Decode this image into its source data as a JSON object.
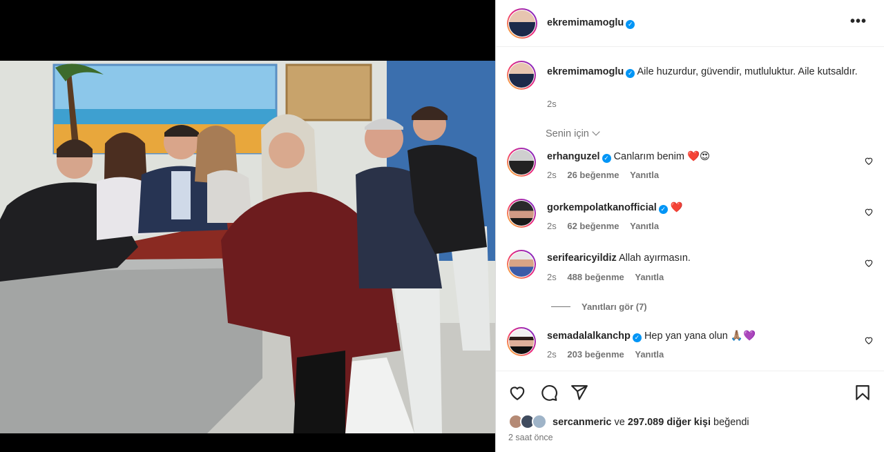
{
  "post": {
    "author": "ekremimamoglu",
    "verified_mark": "✓",
    "more_icon": "more-horizontal-icon",
    "caption_text": "Aile huzurdur, güvendir, mutluluktur. Aile kutsaldır.",
    "caption_time": "2s",
    "sort_label": "Senin için"
  },
  "comments": [
    {
      "user": "erhanguzel",
      "text": "Canlarım benim ❤️😍",
      "time": "2s",
      "likes": "26 beğenme",
      "reply": "Yanıtla"
    },
    {
      "user": "gorkempolatkanofficial",
      "text": "❤️",
      "time": "2s",
      "likes": "62 beğenme",
      "reply": "Yanıtla"
    },
    {
      "user": "serifearicyildiz",
      "text": "Allah ayırmasın.",
      "time": "2s",
      "likes": "488 beğenme",
      "reply": "Yanıtla"
    },
    {
      "user": "semadalalkanchp",
      "text": "Hep yan yana olun 🙏🏽💜",
      "time": "2s",
      "likes": "203 beğenme",
      "reply": "Yanıtla"
    }
  ],
  "replies_toggle": "Yanıtları gör (7)",
  "likes_summary": {
    "user": "sercanmeric",
    "connector": "ve",
    "count": "297.089 diğer kişi",
    "suffix": "beğendi"
  },
  "posted_ago": "2 saat önce",
  "colors": {
    "link_blue": "#0095f6",
    "text": "#262626",
    "muted": "#737373"
  }
}
